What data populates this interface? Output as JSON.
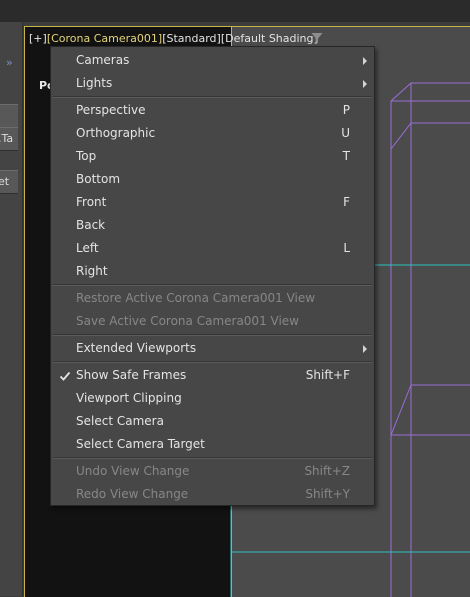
{
  "viewport": {
    "header": {
      "plus": "[+]",
      "camera": "[Corona Camera001]",
      "mode": "[Standard]",
      "shading": "[Default Shading]"
    },
    "pov_label": "Po"
  },
  "side_panel": {
    "tabs": [
      ".Ta",
      "et"
    ]
  },
  "menu": {
    "cameras": {
      "label": "Cameras"
    },
    "lights": {
      "label": "Lights"
    },
    "perspective": {
      "label": "Perspective",
      "shortcut": "P"
    },
    "orthographic": {
      "label": "Orthographic",
      "shortcut": "U"
    },
    "top": {
      "label": "Top",
      "shortcut": "T"
    },
    "bottom": {
      "label": "Bottom"
    },
    "front": {
      "label": "Front",
      "shortcut": "F"
    },
    "back": {
      "label": "Back"
    },
    "left": {
      "label": "Left",
      "shortcut": "L"
    },
    "right": {
      "label": "Right"
    },
    "restore_view": {
      "label": "Restore Active Corona Camera001 View"
    },
    "save_view": {
      "label": "Save Active Corona Camera001 View"
    },
    "extended": {
      "label": "Extended Viewports"
    },
    "safe_frames": {
      "label": "Show Safe Frames",
      "shortcut": "Shift+F",
      "checked": true
    },
    "clipping": {
      "label": "Viewport Clipping"
    },
    "select_camera": {
      "label": "Select Camera"
    },
    "select_target": {
      "label": "Select Camera Target"
    },
    "undo_view": {
      "label": "Undo View Change",
      "shortcut": "Shift+Z"
    },
    "redo_view": {
      "label": "Redo View Change",
      "shortcut": "Shift+Y"
    }
  },
  "colors": {
    "accent_border": "#c7b54a",
    "wire_purple": "#9b6fd6",
    "wire_cyan": "#2fc2c2",
    "disabled_text": "#878787"
  }
}
